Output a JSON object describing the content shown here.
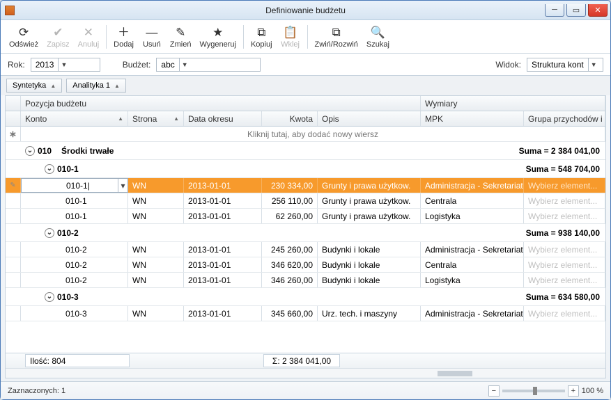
{
  "window": {
    "title": "Definiowanie budżetu"
  },
  "toolbar": {
    "refresh": "Odśwież",
    "save": "Zapisz",
    "cancel": "Anuluj",
    "add": "Dodaj",
    "remove": "Usuń",
    "edit": "Zmień",
    "generate": "Wygeneruj",
    "copy": "Kopiuj",
    "paste": "Wklej",
    "collapse": "Zwiń/Rozwiń",
    "search": "Szukaj"
  },
  "filters": {
    "year_label": "Rok:",
    "year_value": "2013",
    "budget_label": "Budżet:",
    "budget_value": "abc",
    "view_label": "Widok:",
    "view_value": "Struktura kont"
  },
  "groupbar": {
    "chip1": "Syntetyka",
    "chip2": "Analityka 1"
  },
  "grid": {
    "header_group_left": "Pozycja budżetu",
    "header_group_right": "Wymiary",
    "cols": {
      "konto": "Konto",
      "strona": "Strona",
      "data": "Data okresu",
      "kwota": "Kwota",
      "opis": "Opis",
      "mpk": "MPK",
      "grupa": "Grupa przychodów i"
    },
    "click_row": "Kliknij tutaj, aby dodać nowy wiersz",
    "placeholder_select": "Wybierz element...",
    "groups": [
      {
        "level": 1,
        "code": "010",
        "label": "Środki trwałe",
        "sum_label": "Suma = 2 384 041,00",
        "children": [
          {
            "level": 2,
            "code": "010-1",
            "label": "",
            "sum_label": "Suma = 548 704,00",
            "rows": [
              {
                "konto": "010-1",
                "strona": "WN",
                "data": "2013-01-01",
                "kwota": "230 334,00",
                "opis": "Grunty i prawa użytkow.",
                "mpk": "Administracja - Sekretariat...",
                "selected": true,
                "editing": true
              },
              {
                "konto": "010-1",
                "strona": "WN",
                "data": "2013-01-01",
                "kwota": "256 110,00",
                "opis": "Grunty i prawa użytkow.",
                "mpk": "Centrala"
              },
              {
                "konto": "010-1",
                "strona": "WN",
                "data": "2013-01-01",
                "kwota": "62 260,00",
                "opis": "Grunty i prawa użytkow.",
                "mpk": "Logistyka"
              }
            ]
          },
          {
            "level": 2,
            "code": "010-2",
            "label": "",
            "sum_label": "Suma = 938 140,00",
            "rows": [
              {
                "konto": "010-2",
                "strona": "WN",
                "data": "2013-01-01",
                "kwota": "245 260,00",
                "opis": "Budynki i lokale",
                "mpk": "Administracja - Sekretariat..."
              },
              {
                "konto": "010-2",
                "strona": "WN",
                "data": "2013-01-01",
                "kwota": "346 620,00",
                "opis": "Budynki i lokale",
                "mpk": "Centrala"
              },
              {
                "konto": "010-2",
                "strona": "WN",
                "data": "2013-01-01",
                "kwota": "346 260,00",
                "opis": "Budynki i lokale",
                "mpk": "Logistyka"
              }
            ]
          },
          {
            "level": 2,
            "code": "010-3",
            "label": "",
            "sum_label": "Suma = 634 580,00",
            "rows": [
              {
                "konto": "010-3",
                "strona": "WN",
                "data": "2013-01-01",
                "kwota": "345 660,00",
                "opis": "Urz. tech. i maszyny",
                "mpk": "Administracja - Sekretariat..."
              }
            ]
          }
        ]
      }
    ],
    "footer": {
      "count_label": "Ilość: 804",
      "sum_label": "Σ: 2 384 041,00"
    }
  },
  "status": {
    "selected": "Zaznaczonych: 1",
    "zoom": "100 %"
  }
}
